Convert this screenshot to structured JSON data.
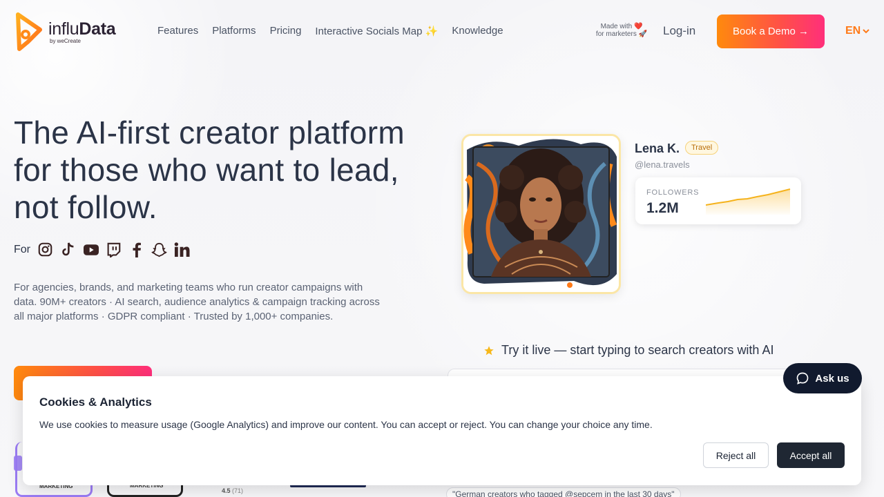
{
  "nav": {
    "logo_name_prefix": "influ",
    "logo_name_suffix": "Data",
    "logo_sub": "by weCreate",
    "links": [
      "Features",
      "Platforms",
      "Pricing",
      "Interactive Socials Map ✨",
      "Knowledge"
    ],
    "made_with_line1": "Made with ❤️",
    "made_with_line2": "for marketers 🚀",
    "login": "Log-in",
    "demo_label": "Book a Demo →",
    "language": "EN"
  },
  "hero": {
    "title": "The AI-first creator platform for those who want to lead, not follow.",
    "for_label": "For",
    "platforms": [
      "instagram-icon",
      "tiktok-icon",
      "youtube-icon",
      "twitch-icon",
      "facebook-icon",
      "snapchat-icon",
      "linkedin-icon"
    ],
    "description": "For agencies, brands, and marketing teams who run creator campaigns with data. 90M+ creators · AI search, audience analytics & campaign tracking across all major platforms · GDPR compliant · Trusted by 1,000+ companies."
  },
  "creator_card": {
    "name": "Lena K.",
    "tag": "Travel",
    "handle": "@lena.travels",
    "followers_label": "FOLLOWERS",
    "followers_value": "1.2M"
  },
  "try_live": "Try it live — start typing to search creators with AI",
  "ask_us": "Ask us",
  "cookie": {
    "title": "Cookies & Analytics",
    "text": "We use cookies to measure usage (Google Analytics) and improve our content. You can accept or reject. You can change your choice any time.",
    "reject": "Reject all",
    "accept": "Accept all"
  },
  "peek": {
    "label_a": "MARKETING",
    "label_b": "MARKETING",
    "rating": "4.5",
    "rating_count": "(71)",
    "quote": "\"German creators who tagged @sepcem in the last 30 days\""
  },
  "colors": {
    "accent_orange": "#ff8a0d",
    "accent_pink": "#ff2f7b",
    "text_dark": "#2b3447",
    "travel_tag": "#b86e0a"
  }
}
